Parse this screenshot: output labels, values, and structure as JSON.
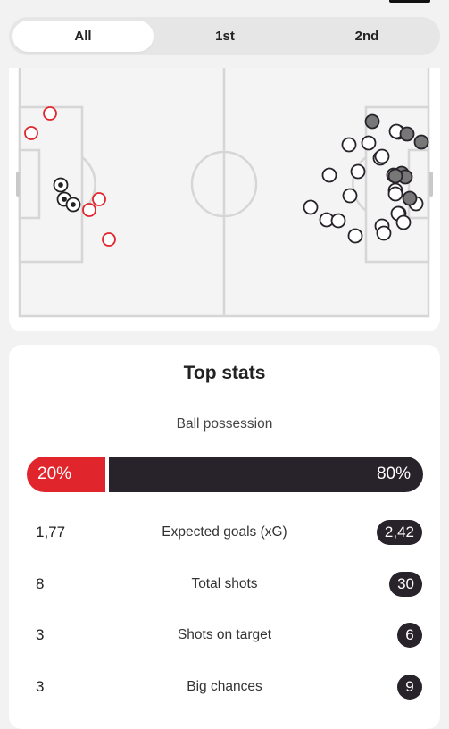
{
  "tabs": [
    {
      "label": "All",
      "active": true
    },
    {
      "label": "1st",
      "active": false
    },
    {
      "label": "2nd",
      "active": false
    }
  ],
  "shot_map": {
    "home_color": "#e0262c",
    "away_color": "#28222a",
    "home_shots": 8,
    "away_shots": 30
  },
  "stats": {
    "title": "Top stats",
    "possession": {
      "label": "Ball possession",
      "home": "20%",
      "away": "80%",
      "home_pct": 20,
      "away_pct": 80
    },
    "rows": [
      {
        "label": "Expected goals (xG)",
        "home": "1,77",
        "away": "2,42"
      },
      {
        "label": "Total shots",
        "home": "8",
        "away": "30"
      },
      {
        "label": "Shots on target",
        "home": "3",
        "away": "6"
      },
      {
        "label": "Big chances",
        "home": "3",
        "away": "9"
      }
    ]
  }
}
